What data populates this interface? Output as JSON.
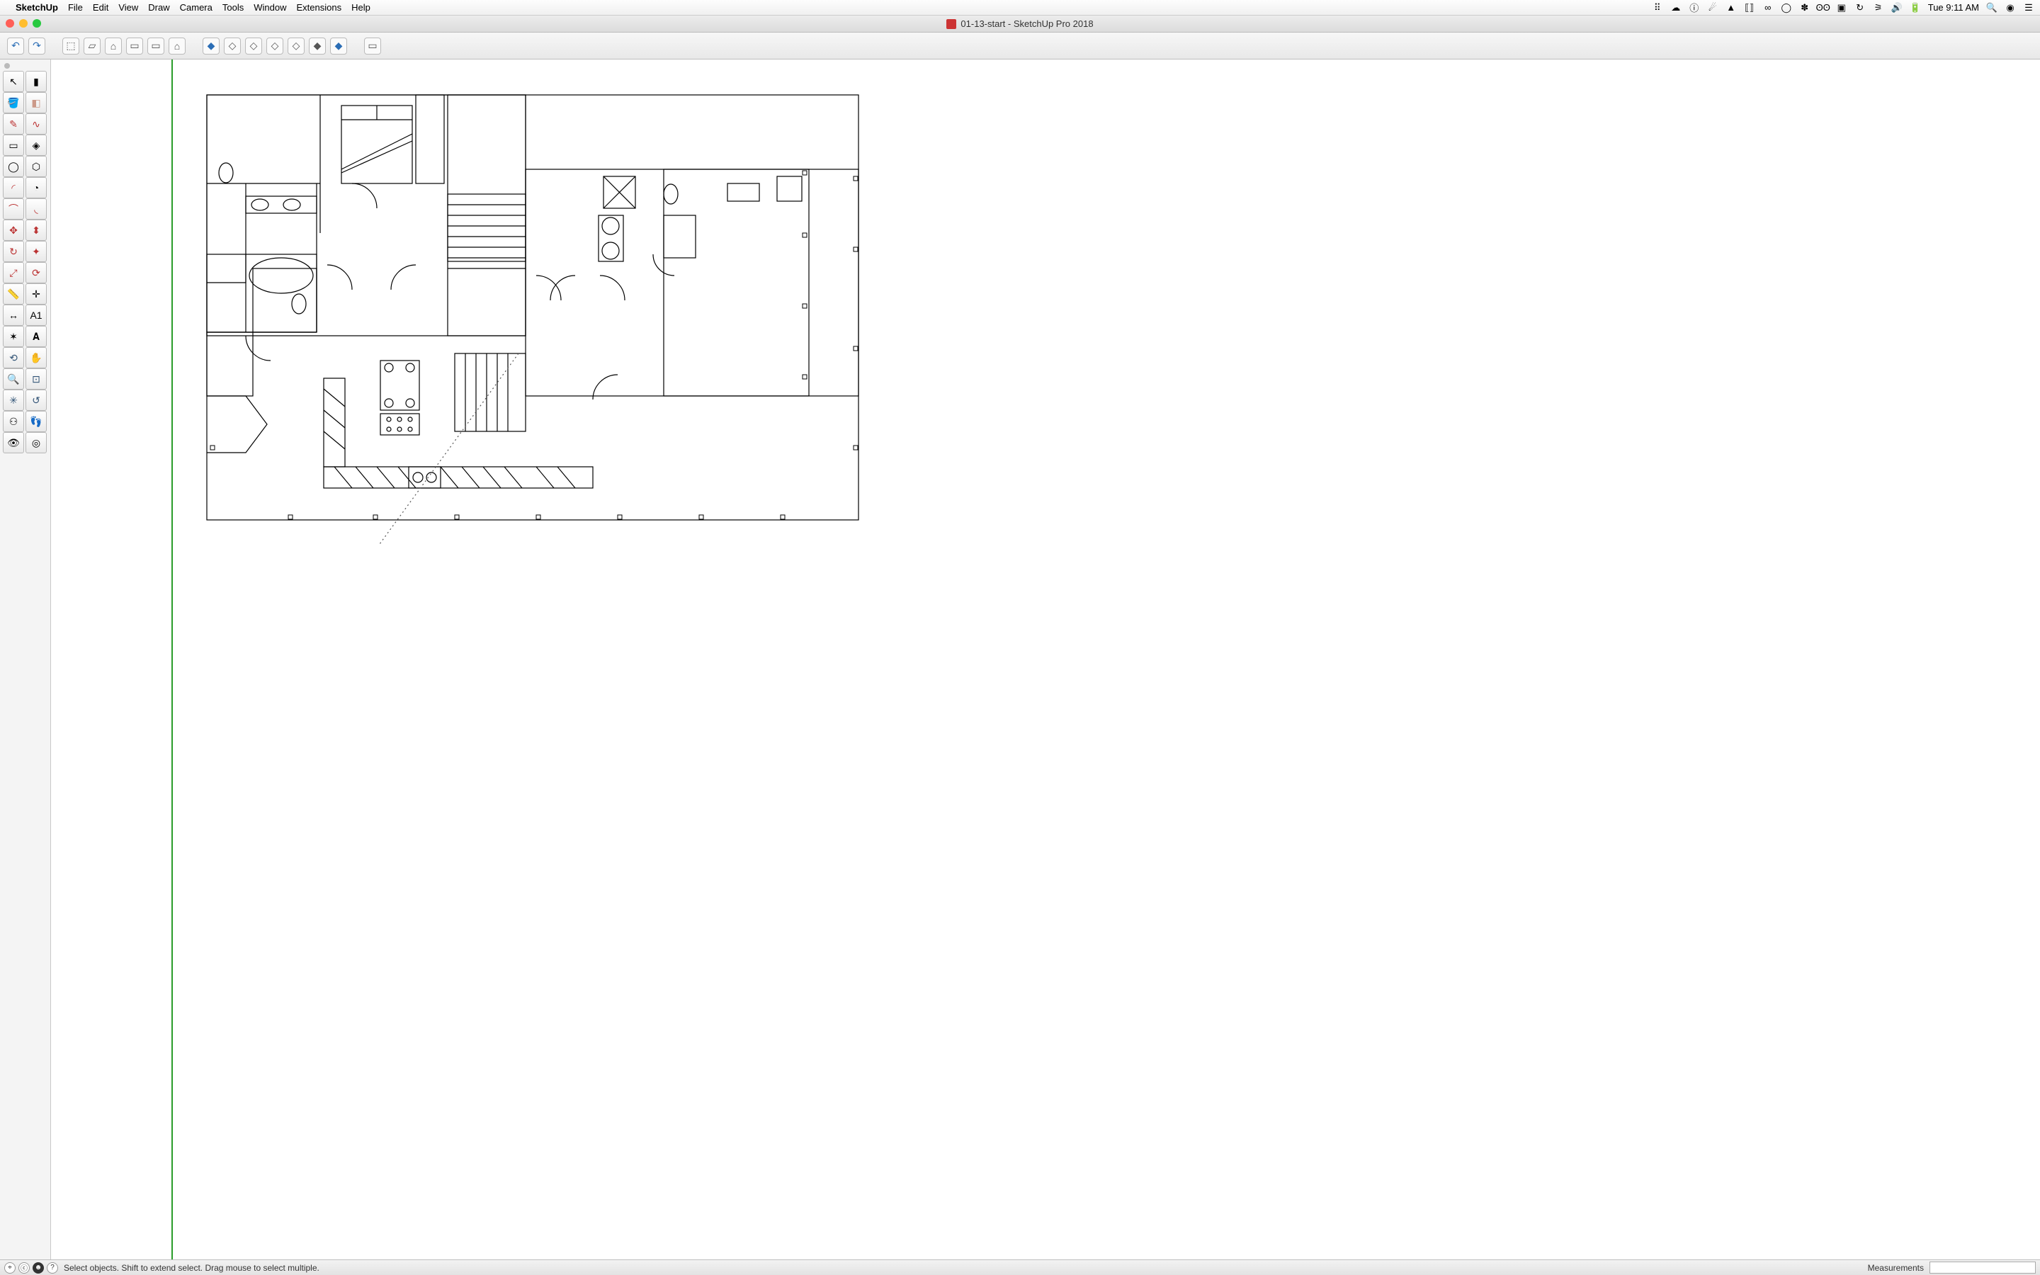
{
  "menubar": {
    "app_name": "SketchUp",
    "items": [
      "File",
      "Edit",
      "View",
      "Draw",
      "Camera",
      "Tools",
      "Window",
      "Extensions",
      "Help"
    ],
    "clock": "Tue 9:11 AM"
  },
  "window": {
    "title": "01-13-start - SketchUp Pro 2018"
  },
  "top_toolbar": {
    "undo": "↶",
    "redo": "↷",
    "views": [
      "⬚",
      "▱",
      "⌂",
      "▭",
      "▭",
      "⌂"
    ],
    "styles": [
      "◆",
      "◇",
      "◇",
      "◇",
      "◇",
      "◆",
      "◆"
    ],
    "layout": "▭"
  },
  "tool_palette": {
    "rows": [
      [
        "select",
        "▮"
      ],
      [
        "paint",
        "eraser"
      ],
      [
        "pencil",
        "freehand"
      ],
      [
        "rect",
        "rot-rect"
      ],
      [
        "circle",
        "polygon"
      ],
      [
        "arc",
        "pie"
      ],
      [
        "arc2",
        "arc3"
      ],
      [
        "move",
        "pushpull"
      ],
      [
        "rotate",
        "followme"
      ],
      [
        "scale",
        "offset"
      ],
      [
        "tape",
        "protractor"
      ],
      [
        "dim",
        "text"
      ],
      [
        "axes",
        "3dtext"
      ],
      [
        "orbit",
        "pan"
      ],
      [
        "zoom",
        "zoom-win"
      ],
      [
        "zoom-ext",
        "prev"
      ],
      [
        "person",
        "walk"
      ],
      [
        "look",
        "section"
      ]
    ],
    "glyphs": {
      "select": "↖",
      "▮": "▮",
      "paint": "🪣",
      "eraser": "◧",
      "pencil": "✎",
      "freehand": "∿",
      "rect": "▭",
      "rot-rect": "◈",
      "circle": "◯",
      "polygon": "⬡",
      "arc": "◜",
      "pie": "◔",
      "arc2": "⌒",
      "arc3": "◟",
      "move": "✥",
      "pushpull": "⬍",
      "rotate": "↻",
      "followme": "✦",
      "scale": "⤢",
      "offset": "⟳",
      "tape": "📏",
      "protractor": "✛",
      "dim": "↔",
      "text": "A1",
      "axes": "✶",
      "3dtext": "𝐀",
      "orbit": "⟲",
      "pan": "✋",
      "zoom": "🔍",
      "zoom-win": "⊡",
      "zoom-ext": "✳",
      "prev": "↺",
      "person": "⚇",
      "walk": "👣",
      "look": "👁",
      "section": "◎"
    }
  },
  "status": {
    "hint": "Select objects. Shift to extend select. Drag mouse to select multiple.",
    "measurements_label": "Measurements",
    "measurements_value": ""
  }
}
